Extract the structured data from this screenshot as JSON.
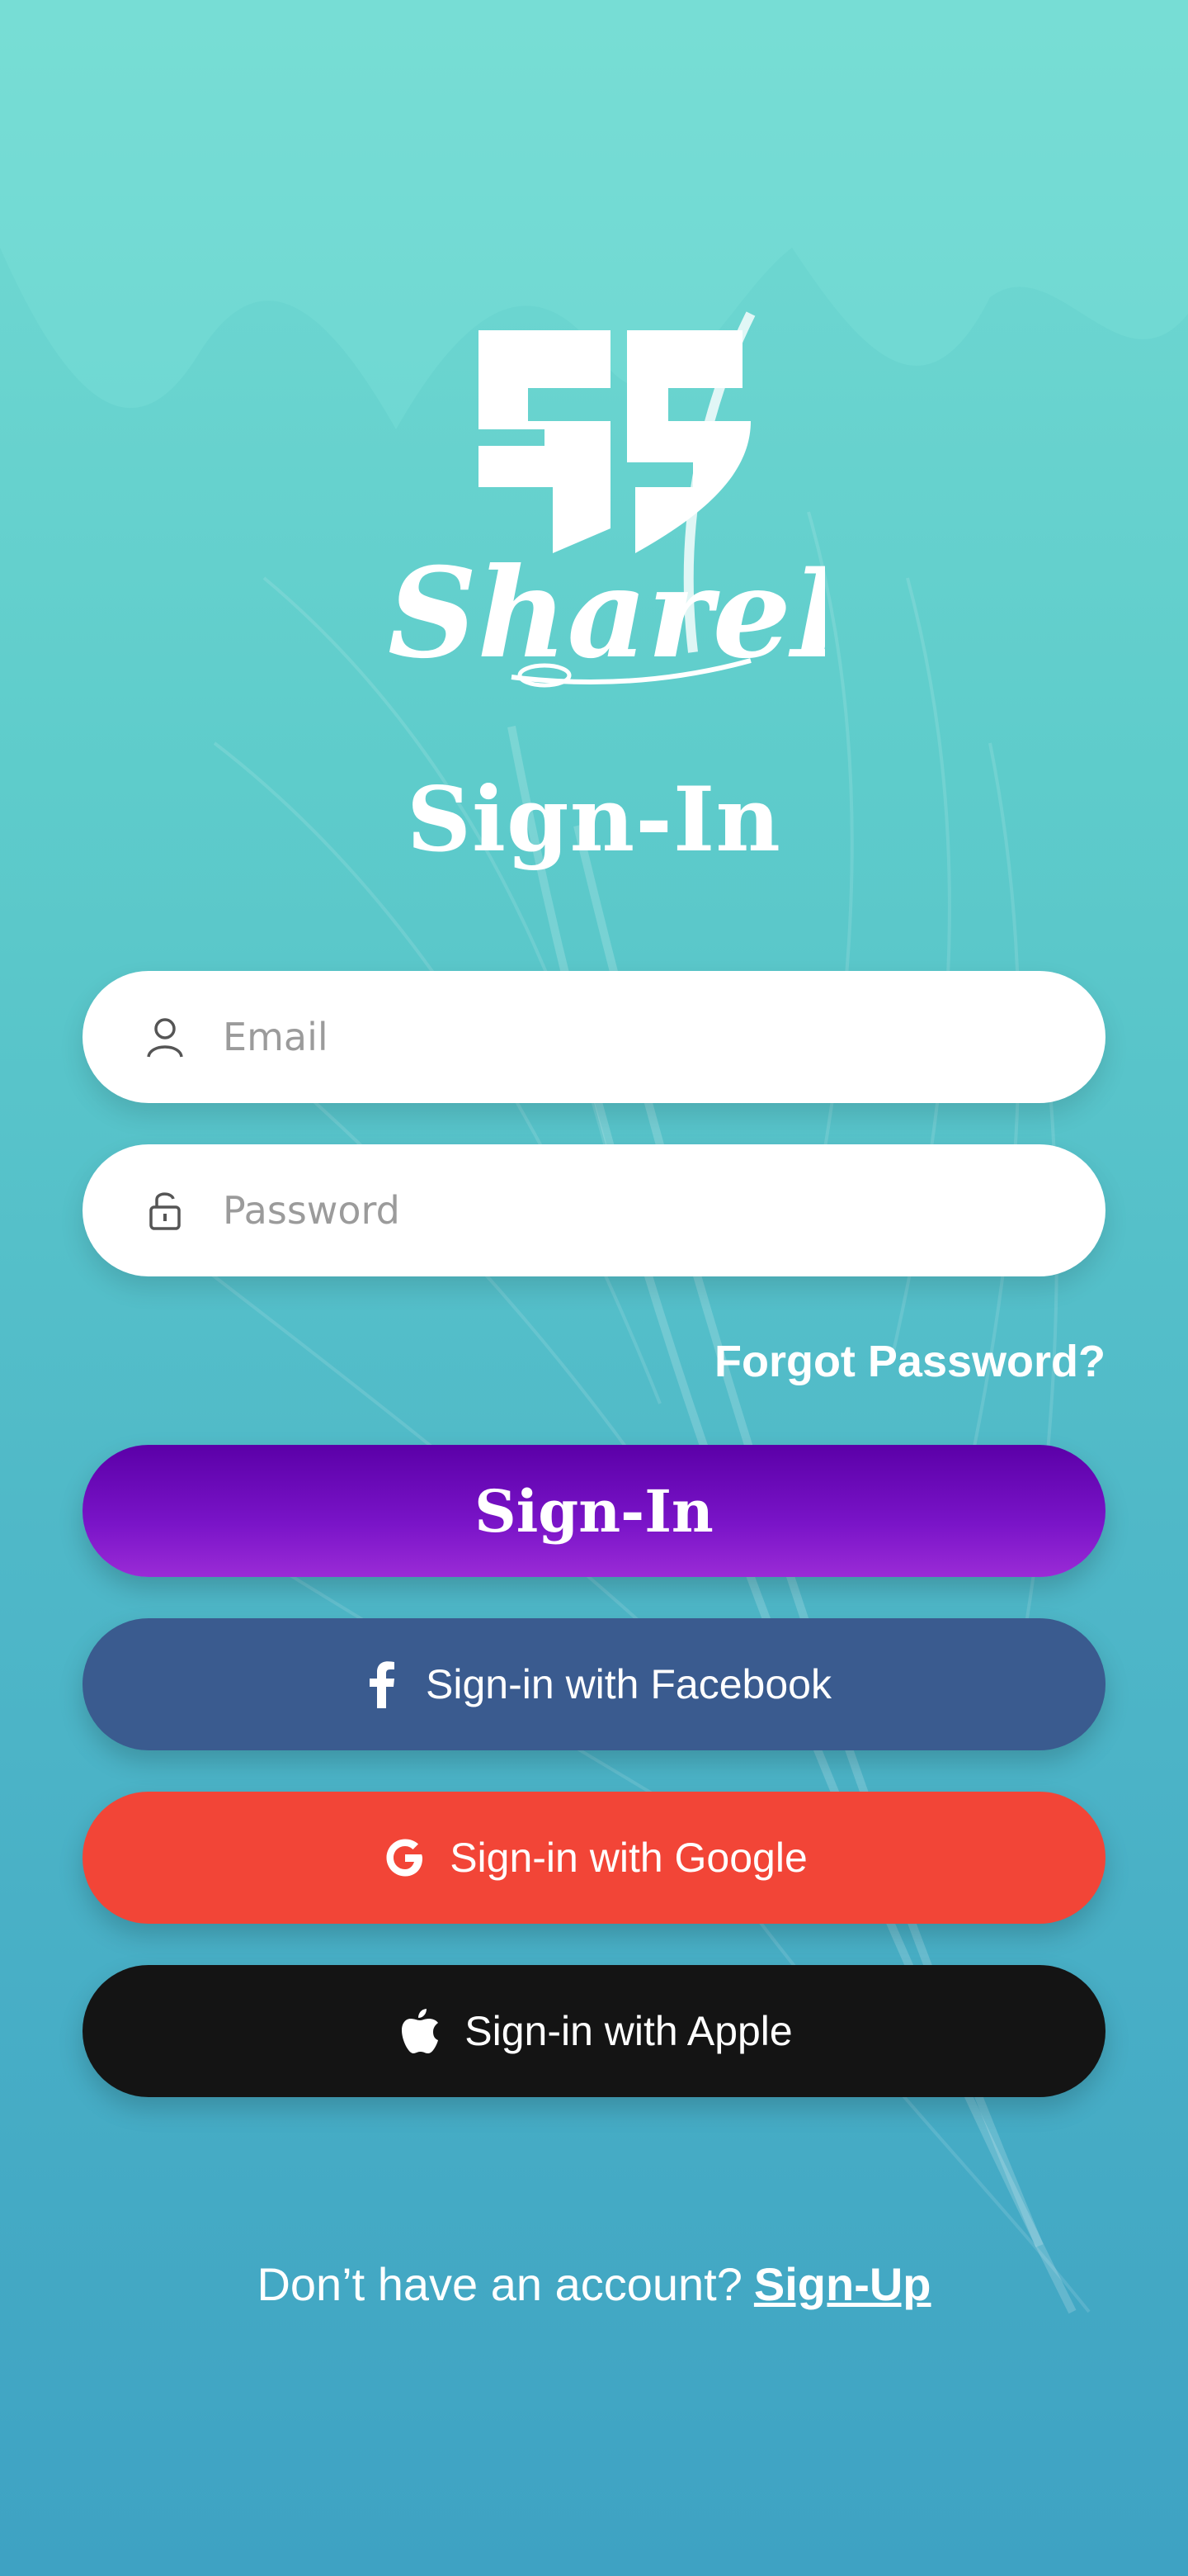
{
  "app": {
    "brand_name": "ShareIt",
    "title": "Sign-In"
  },
  "form": {
    "email": {
      "placeholder": "Email",
      "value": ""
    },
    "password": {
      "placeholder": "Password",
      "value": ""
    },
    "forgot_label": "Forgot Password?"
  },
  "buttons": {
    "signin_label": "Sign-In",
    "facebook_label": "Sign-in with Facebook",
    "google_label": "Sign-in with Google",
    "apple_label": "Sign-in with Apple"
  },
  "footer": {
    "prompt": "Don’t have an account?",
    "signup_label": "Sign-Up"
  },
  "icons": {
    "email": "user-icon",
    "password": "unlock-icon",
    "facebook": "facebook-icon",
    "google": "google-icon",
    "apple": "apple-icon"
  },
  "colors": {
    "bg_top": "#74dbd3",
    "bg_bottom": "#3ea2c3",
    "signin_button": "#6a0bb8",
    "facebook_button": "#3a5b8f",
    "google_button": "#f24537",
    "apple_button": "#141414"
  }
}
